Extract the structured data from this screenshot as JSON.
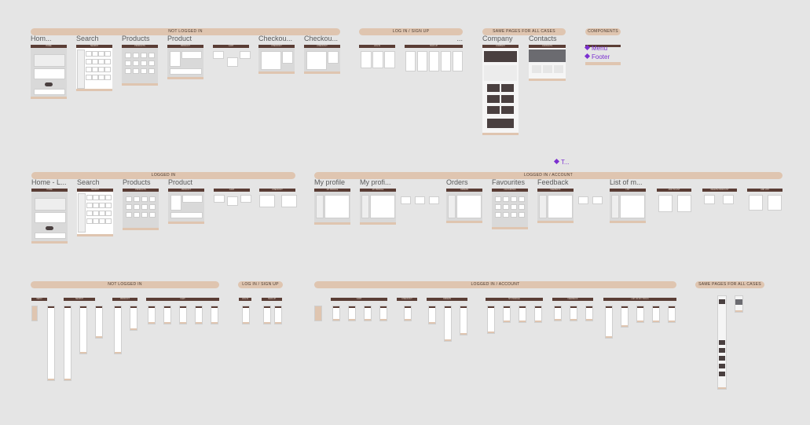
{
  "row1": {
    "sections": [
      {
        "label": "NOT LOGGED IN"
      },
      {
        "label": "LOG IN / SIGN UP"
      },
      {
        "label": "SAME PAGES FOR ALL CASES"
      },
      {
        "label": "COMPONENTS"
      }
    ],
    "frames": [
      {
        "name": "Hom...",
        "header": "HOME"
      },
      {
        "name": "Search",
        "header": "SEARCH"
      },
      {
        "name": "Products",
        "header": "PRODUCTS"
      },
      {
        "name": "Product",
        "header": "PRODUCT"
      },
      {
        "name": "",
        "header": "CART"
      },
      {
        "name": "Checkou...",
        "header": "CHECKOUT"
      },
      {
        "name": "Checkou...",
        "header": "CHECKOUT"
      },
      {
        "name": "",
        "header": "LOG IN"
      },
      {
        "name": "...",
        "header": "SIGN UP"
      },
      {
        "name": "Company",
        "header": "COMPANY"
      },
      {
        "name": "Contacts",
        "header": "CONTACTS"
      }
    ],
    "components": [
      {
        "label": "Menu"
      },
      {
        "label": "Footer"
      }
    ]
  },
  "floating_component": {
    "label": "T..."
  },
  "row2": {
    "sections": [
      {
        "label": "LOGGED IN"
      },
      {
        "label": "LOGGED IN / ACCOUNT"
      }
    ],
    "frames": [
      {
        "name": "Home - L...",
        "header": "HOME"
      },
      {
        "name": "Search",
        "header": "SEARCH"
      },
      {
        "name": "Products",
        "header": "PRODUCTS"
      },
      {
        "name": "Product",
        "header": "PRODUCT"
      },
      {
        "name": "",
        "header": "CART"
      },
      {
        "name": "",
        "header": "CHECKOUT"
      },
      {
        "name": "My profile",
        "header": "MY PROFILE"
      },
      {
        "name": "My profi...",
        "header": "MY PROFILE"
      },
      {
        "name": "Orders",
        "header": "ORDERS"
      },
      {
        "name": "Favourites",
        "header": "FAVOURITES"
      },
      {
        "name": "Feedback",
        "header": "FEEDBACK"
      },
      {
        "name": "List of m...",
        "header": "LIST"
      },
      {
        "name": "",
        "header": "ADD TO LIST"
      },
      {
        "name": "",
        "header": "DELETE FROM LIST"
      },
      {
        "name": "",
        "header": "ADD LIST"
      }
    ]
  },
  "row3": {
    "sections": [
      {
        "label": "NOT LOGGED IN"
      },
      {
        "label": "LOG IN / SIGN UP"
      },
      {
        "label": "LOGGED IN / ACCOUNT"
      },
      {
        "label": "SAME PAGES FOR ALL CASES"
      }
    ],
    "groups": [
      {
        "header": "MENU"
      },
      {
        "header": "SEARCH"
      },
      {
        "header": "PRODUCT"
      },
      {
        "header": "CART"
      },
      {
        "header": "LOG IN"
      },
      {
        "header": "SIGN UP"
      },
      {
        "header": "CART"
      },
      {
        "header": "CHECKOUT"
      },
      {
        "header": "ORDERS"
      },
      {
        "header": "MY PROFILE"
      },
      {
        "header": "FEEDBACK"
      },
      {
        "header": "LIST OF MY TOOLS"
      }
    ]
  },
  "colors": {
    "canvas": "#e5e5e5",
    "section_pill": "#dfc5b0",
    "frame_header": "#5a3d35",
    "component_accent": "#7b2fd0"
  }
}
